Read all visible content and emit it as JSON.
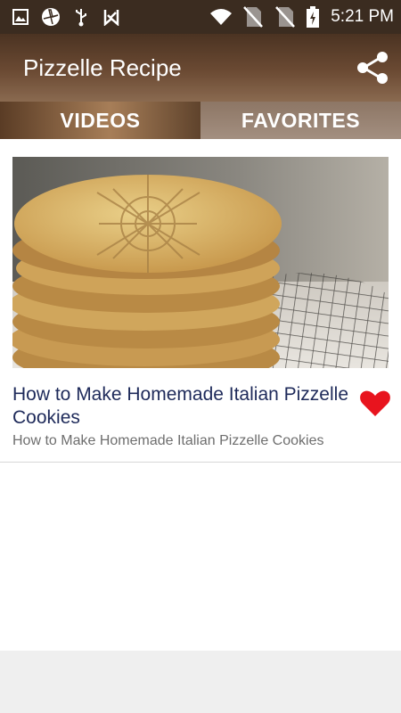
{
  "status_bar": {
    "time": "5:21 PM",
    "left_icons": [
      "image-icon",
      "pinwheel-icon",
      "usb-icon",
      "checkmark-flag-icon"
    ],
    "right_icons": [
      "wifi-icon",
      "no-sim-icon",
      "no-sim-icon",
      "battery-charging-icon"
    ]
  },
  "app_bar": {
    "title": "Pizzelle Recipe",
    "share_icon": "share-icon"
  },
  "tabs": [
    {
      "label": "VIDEOS",
      "active": true
    },
    {
      "label": "FAVORITES",
      "active": false
    }
  ],
  "videos": [
    {
      "title": "How to Make Homemade Italian Pizzelle Cookies",
      "description": "How to Make Homemade Italian Pizzelle Cookies",
      "favorite": true,
      "favorite_icon": "heart-icon"
    }
  ],
  "colors": {
    "status_bar": "#3b2c20",
    "app_bar": "#6b4a33",
    "title_text": "#1e2a5a",
    "heart": "#e8141e"
  }
}
